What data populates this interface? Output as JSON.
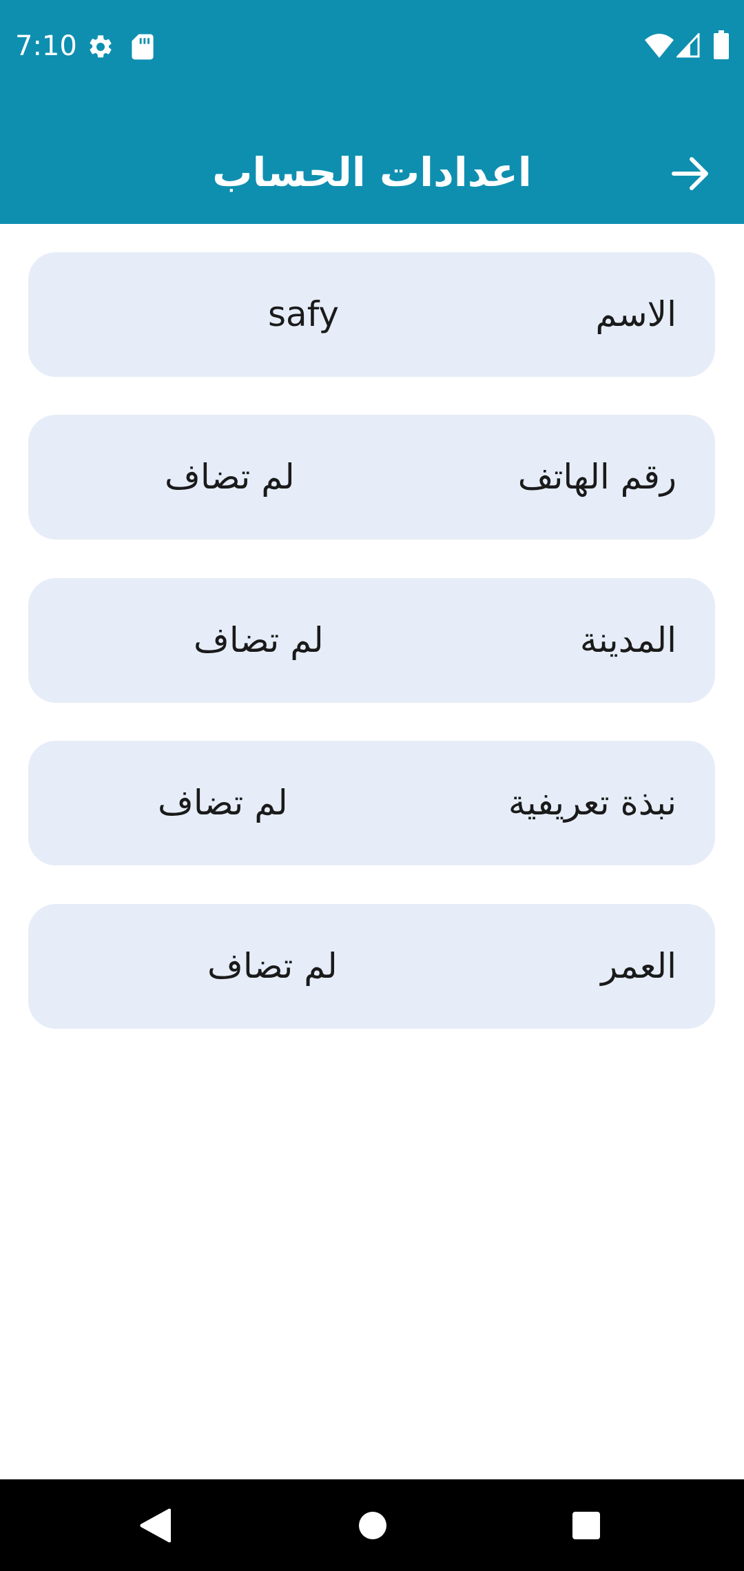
{
  "status_bar": {
    "time": "7:10",
    "icons": [
      "gear-icon",
      "sd-card-icon",
      "wifi-icon",
      "signal-icon",
      "battery-icon"
    ]
  },
  "toolbar": {
    "title": "اعدادات الحساب",
    "back_icon": "arrow-right-icon",
    "background_color": "#0e8fb0"
  },
  "fields": [
    {
      "label": "الاسم",
      "value": "safy"
    },
    {
      "label": "رقم الهاتف",
      "value": "لم تضاف"
    },
    {
      "label": "المدينة",
      "value": "لم تضاف"
    },
    {
      "label": "نبذة تعريفية",
      "value": "لم تضاف"
    },
    {
      "label": "العمر",
      "value": "لم تضاف"
    }
  ],
  "colors": {
    "card_background": "#e6edf8",
    "text": "#1a1a1a"
  },
  "navigation_bar": {
    "buttons": [
      "back-triangle-icon",
      "home-circle-icon",
      "recents-square-icon"
    ]
  }
}
